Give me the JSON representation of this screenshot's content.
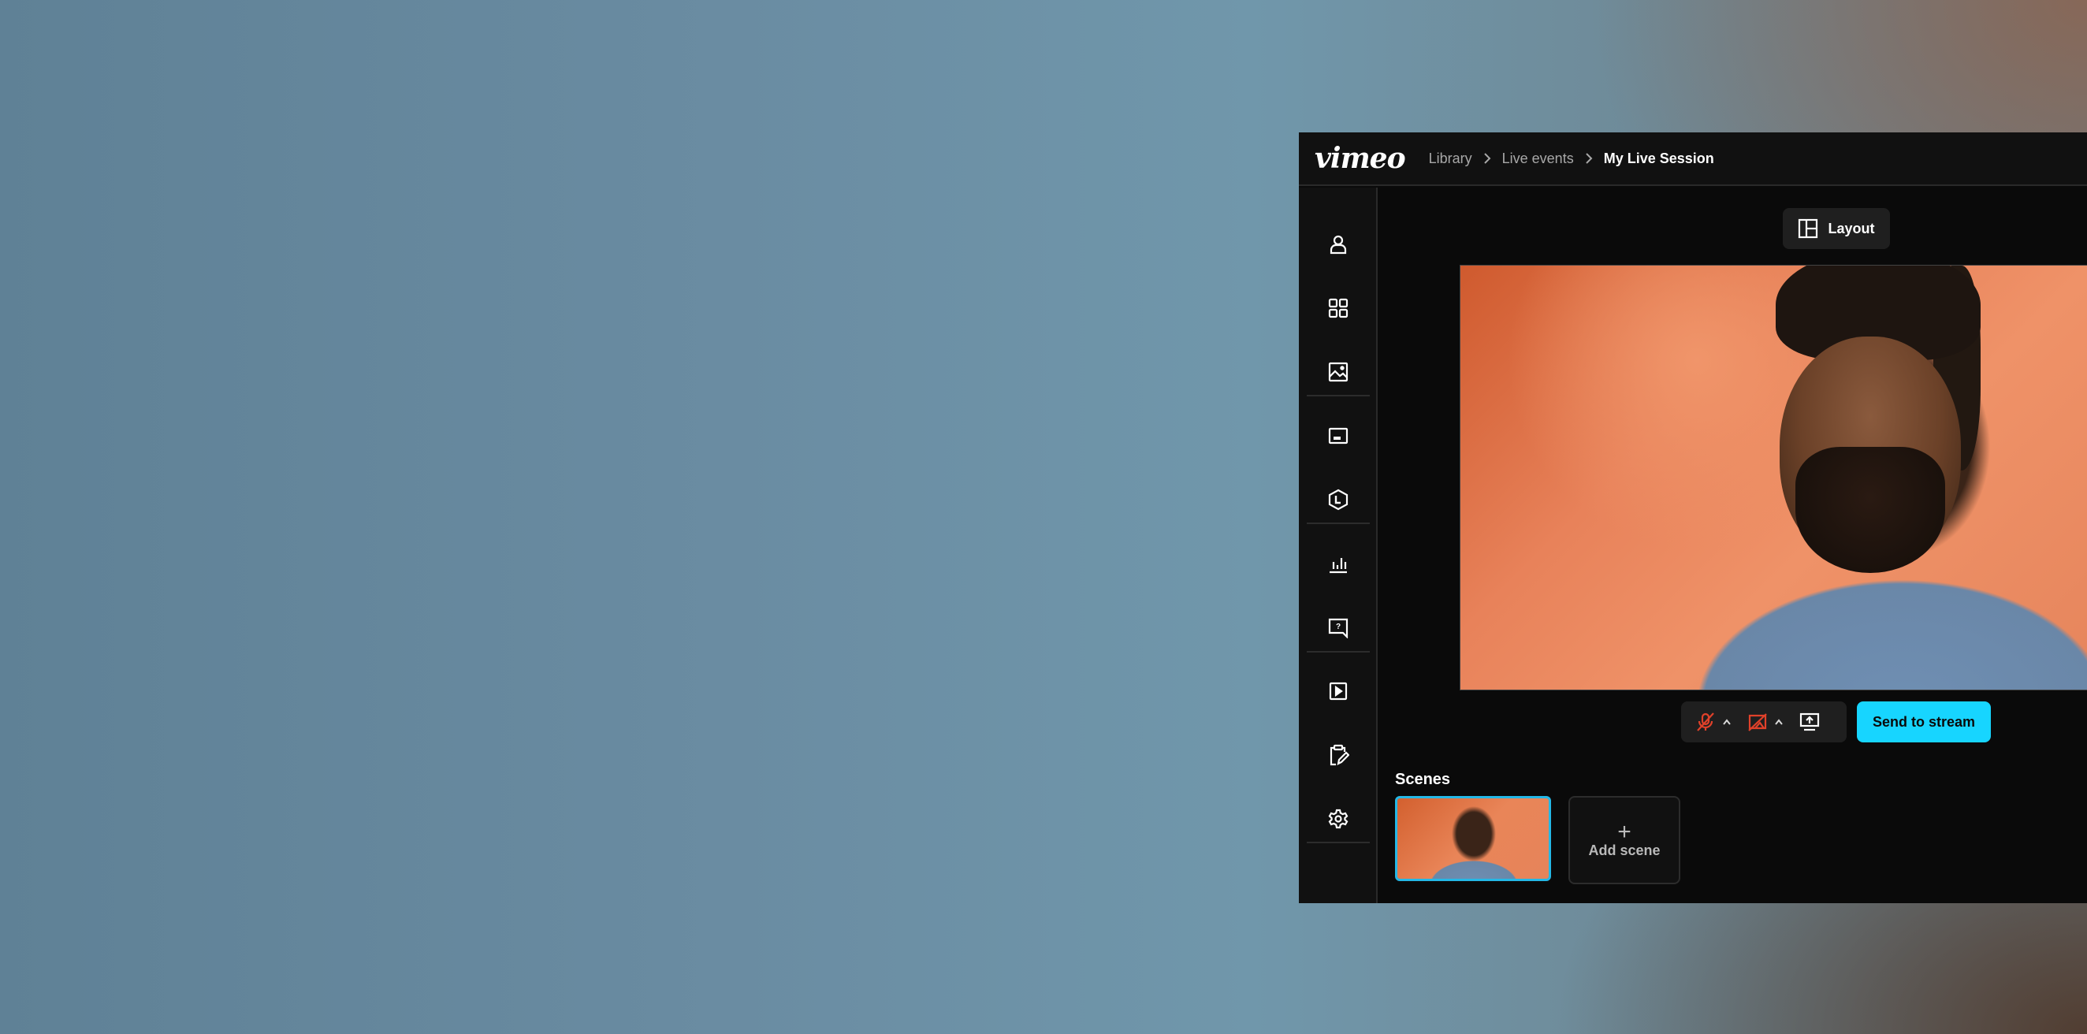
{
  "app": {
    "logo": "vimeo"
  },
  "breadcrumb": [
    {
      "label": "Library"
    },
    {
      "label": "Live events"
    },
    {
      "label": "My Live Session"
    }
  ],
  "sidebar": {
    "items": [
      {
        "icon": "person-icon",
        "label": "People"
      },
      {
        "icon": "grid-icon",
        "label": "Layouts"
      },
      {
        "icon": "image-icon",
        "label": "Media"
      },
      {
        "icon": "banner-icon",
        "label": "Banners"
      },
      {
        "icon": "logo-hexagon-icon",
        "label": "Logo"
      },
      {
        "icon": "poll-chart-icon",
        "label": "Polls"
      },
      {
        "icon": "question-chat-icon",
        "label": "Q&A"
      },
      {
        "icon": "play-video-icon",
        "label": "Videos"
      },
      {
        "icon": "clipboard-edit-icon",
        "label": "Notes"
      },
      {
        "icon": "gear-icon",
        "label": "Settings"
      }
    ]
  },
  "toolbar": {
    "layout_label": "Layout"
  },
  "controls": {
    "mic": {
      "icon": "mic-muted-icon",
      "state": "off"
    },
    "camera": {
      "icon": "camera-off-icon",
      "state": "off"
    },
    "screen_share": {
      "icon": "screen-share-icon"
    },
    "send_label": "Send to stream"
  },
  "scenes": {
    "title": "Scenes",
    "add_label": "Add scene",
    "add_icon": "+"
  },
  "colors": {
    "accent": "#17d5ff",
    "muted_red": "#e0412a",
    "selected_border": "#24b8e6"
  }
}
